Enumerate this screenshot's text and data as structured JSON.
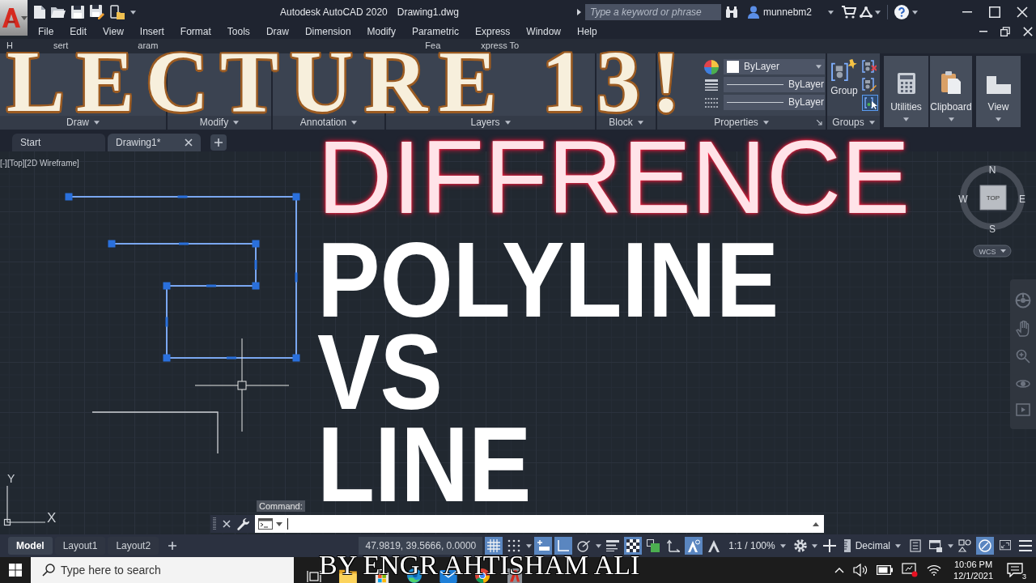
{
  "title_bar": {
    "app_title": "Autodesk AutoCAD 2020",
    "document": "Drawing1.dwg",
    "search": {
      "placeholder": "Type a keyword or phrase"
    },
    "user": "munnebm2"
  },
  "menu_bar": [
    "File",
    "Edit",
    "View",
    "Insert",
    "Format",
    "Tools",
    "Draw",
    "Dimension",
    "Modify",
    "Parametric",
    "Express",
    "Window",
    "Help"
  ],
  "ribbon_tabs": [
    "H",
    "sert",
    "aram",
    "Fea",
    "xpress To"
  ],
  "ribbon_panels": [
    {
      "kind": "plain",
      "title": "Draw"
    },
    {
      "kind": "plain",
      "title": "Modify"
    },
    {
      "kind": "plain",
      "title": "Annotation"
    },
    {
      "kind": "plain",
      "title": "Layers"
    },
    {
      "kind": "plain",
      "title": "Block"
    },
    {
      "kind": "properties",
      "title": "Properties",
      "rows": [
        {
          "kind": "color",
          "value": "ByLayer"
        },
        {
          "kind": "lineweight",
          "value": "ByLayer"
        },
        {
          "kind": "linetype",
          "value": "ByLayer"
        }
      ]
    },
    {
      "kind": "groups",
      "title": "Groups",
      "button": "Group"
    },
    {
      "kind": "utilities",
      "label": "Utilities"
    },
    {
      "kind": "clipboard",
      "label": "Clipboard"
    },
    {
      "kind": "view",
      "label": "View"
    }
  ],
  "file_tabs": [
    {
      "label": "Start",
      "selected": false
    },
    {
      "label": "Drawing1*",
      "selected": true
    }
  ],
  "viewport": {
    "label": "[-][Top][2D Wireframe]",
    "objects": [
      {
        "kind": "polyline",
        "selected": true
      },
      {
        "kind": "line",
        "selected": false
      }
    ],
    "ucs": {
      "x_axis": "X",
      "y_axis": "Y"
    },
    "viewcube": {
      "face": "TOP",
      "north": "N",
      "west": "W",
      "east": "E",
      "south": "S",
      "coordinate_system": "WCS"
    }
  },
  "command_line": {
    "prompt": "Command:"
  },
  "layout_tabs": [
    {
      "label": "Model",
      "selected": true
    },
    {
      "label": "Layout1",
      "selected": false
    },
    {
      "label": "Layout2",
      "selected": false
    }
  ],
  "status_bar": {
    "coordinates": "47.9819, 39.5666, 0.0000",
    "items": [
      {
        "kind": "grid",
        "on": true,
        "menu": false
      },
      {
        "kind": "snap",
        "on": false,
        "menu": true
      },
      {
        "kind": "dynamic-input",
        "on": true,
        "menu": false
      },
      {
        "kind": "ortho",
        "on": true,
        "menu": false
      },
      {
        "kind": "polar",
        "on": false,
        "menu": true
      },
      {
        "kind": "lineweight",
        "on": false,
        "menu": false
      },
      {
        "kind": "transparency",
        "on": true,
        "menu": false
      },
      {
        "kind": "selection-cycling",
        "on": false,
        "menu": false
      },
      {
        "kind": "ucs",
        "on": false,
        "menu": false
      },
      {
        "kind": "annotation-visibility",
        "on": true,
        "menu": false
      },
      {
        "kind": "auto-scale",
        "on": false,
        "menu": false
      },
      {
        "kind": "scale",
        "text": "1:1 / 100%",
        "menu": true
      },
      {
        "kind": "workspace",
        "on": false,
        "menu": true
      },
      {
        "kind": "annotation-monitor",
        "on": false,
        "menu": false
      },
      {
        "kind": "units",
        "text": "Decimal",
        "menu": true
      },
      {
        "kind": "quick-properties",
        "on": false,
        "menu": false
      },
      {
        "kind": "lock-ui",
        "on": false,
        "menu": true
      },
      {
        "kind": "isolate",
        "on": false,
        "menu": false
      },
      {
        "kind": "hardware-acceleration",
        "on": true,
        "menu": false
      },
      {
        "kind": "clean-screen",
        "on": false,
        "menu": false
      },
      {
        "kind": "customize",
        "on": false,
        "menu": false
      }
    ]
  },
  "taskbar": {
    "search": {
      "placeholder": "Type here to search"
    },
    "time": "10:06 PM",
    "date": "12/1/2021",
    "notifications": "3"
  },
  "overlay": {
    "heading": "LECTURE 13!",
    "neon_title": "DIFFRENCE",
    "title_lines": [
      "POLYLINE",
      "VS",
      "LINE"
    ],
    "credit": "BY ENGR AHTISHAM ALI"
  }
}
